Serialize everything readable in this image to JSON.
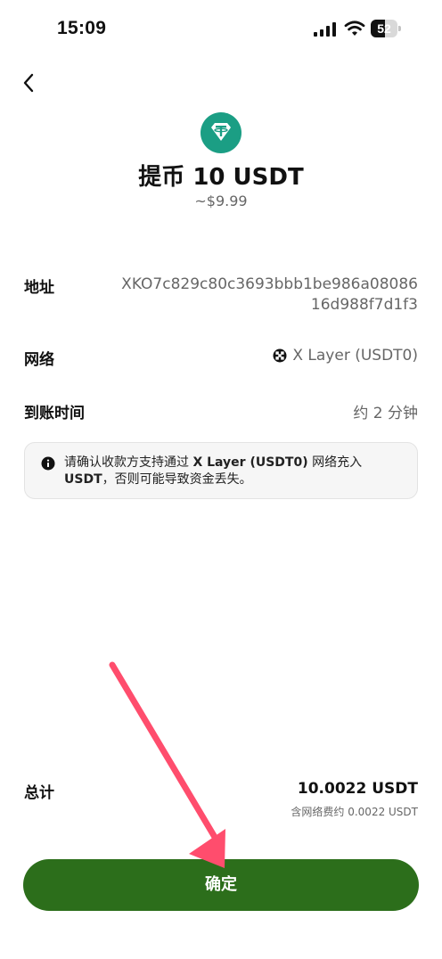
{
  "status_bar": {
    "time": "15:09",
    "battery": "52",
    "battery_level": 0.52
  },
  "header": {
    "title": "提币 10 USDT",
    "subtitle": "~$9.99"
  },
  "details": {
    "address_label": "地址",
    "address_value": "XKO7c829c80c3693bbb1be986a0808616d988f7d1f3",
    "network_label": "网络",
    "network_value": "X Layer (USDT0)",
    "time_label": "到账时间",
    "time_value": "约 2 分钟"
  },
  "notice": {
    "text_before": "请确认收款方支持通过 ",
    "text_bold1": "X Layer (USDT0)",
    "text_middle": " 网络充入 ",
    "text_bold2": "USDT",
    "text_after": "，否则可能导致资金丢失。"
  },
  "total": {
    "label": "总计",
    "value": "10.0022 USDT",
    "fee": "含网络费约 0.0022 USDT"
  },
  "confirm_label": "确定",
  "colors": {
    "button": "#2c6e1b",
    "token": "#1b9e84",
    "annotation_arrow": "#ff4d6d"
  },
  "icons": [
    "signal-icon",
    "wifi-icon",
    "back-chevron-icon",
    "tether-icon",
    "okx-network-icon",
    "info-icon"
  ]
}
